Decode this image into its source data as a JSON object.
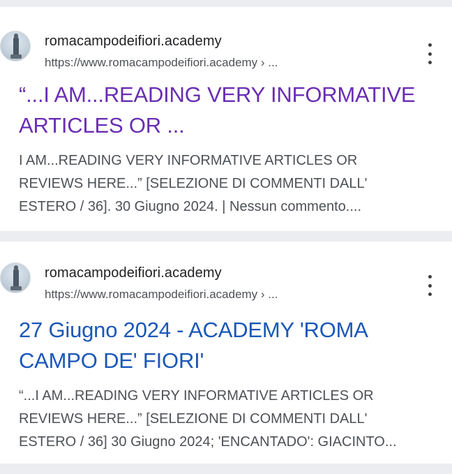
{
  "results": [
    {
      "site_name": "romacampodeifiori.academy",
      "url": "https://www.romacampodeifiori.academy › ...",
      "title_line1": "“...I AM...READING VERY INFORMATIVE",
      "title_line2": "ARTICLES OR ...",
      "snippet_line1": "I AM...READING VERY INFORMATIVE ARTICLES OR",
      "snippet_line2": "REVIEWS HERE...” [SELEZIONE DI COMMENTI DALL'",
      "snippet_line3": "ESTERO / 36]. 30 Giugno 2024. | Nessun commento....",
      "title_color": "#6a2db3",
      "favicon_icon": "tower-favicon-icon",
      "menu_icon": "more-vert-icon"
    },
    {
      "site_name": "romacampodeifiori.academy",
      "url": "https://www.romacampodeifiori.academy › ...",
      "title_line1": "27 Giugno 2024 - ACADEMY 'ROMA",
      "title_line2": "CAMPO DE' FIORI'",
      "snippet_line1": "“...I AM...READING VERY INFORMATIVE ARTICLES OR",
      "snippet_line2": "REVIEWS HERE...” [SELEZIONE DI COMMENTI DALL'",
      "snippet_line3": "ESTERO / 36] 30 Giugno 2024; 'ENCANTADO': GIACINTO...",
      "title_color": "#1a57b8",
      "favicon_icon": "tower-favicon-icon",
      "menu_icon": "more-vert-icon"
    }
  ]
}
